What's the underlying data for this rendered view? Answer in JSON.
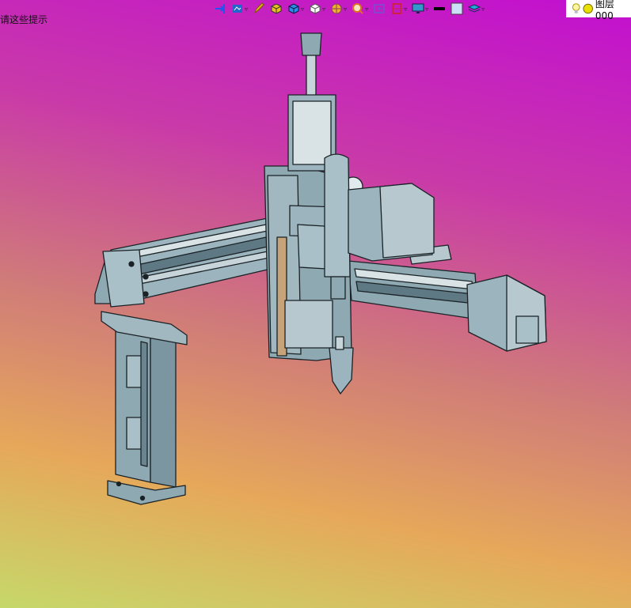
{
  "status": {
    "hint_text": "请这些提示"
  },
  "toolbar": {
    "items": [
      {
        "name": "move-tool-icon",
        "color": "#2255ee"
      },
      {
        "name": "view-style-icon",
        "color": "#2266cc"
      },
      {
        "name": "pencil-icon",
        "color": "#e8b020"
      },
      {
        "name": "box-yellow-icon",
        "color": "#e8c020"
      },
      {
        "name": "box-blue-icon",
        "color": "#2a8ee8"
      },
      {
        "name": "cube-white-icon",
        "color": "#ffffff"
      },
      {
        "name": "render-wheel-icon",
        "color": "#f0b030"
      },
      {
        "name": "zoom-icon",
        "color": "#e07020"
      },
      {
        "name": "snapshot-icon",
        "color": "#8844cc"
      },
      {
        "name": "section-icon",
        "color": "#cc2244"
      },
      {
        "name": "display-icon",
        "color": "#3399cc"
      },
      {
        "name": "line-color-icon",
        "color": "#000000"
      },
      {
        "name": "fill-color-icon",
        "color": "#cce0f8"
      },
      {
        "name": "layer-stack-icon",
        "color": "#22aadd"
      }
    ],
    "layer_label": "图层000"
  },
  "colors": {
    "part": "#8fa9b3",
    "edge": "#1a2226",
    "bg_top": "#c20fd0",
    "bg_bottom": "#c6d86a"
  }
}
